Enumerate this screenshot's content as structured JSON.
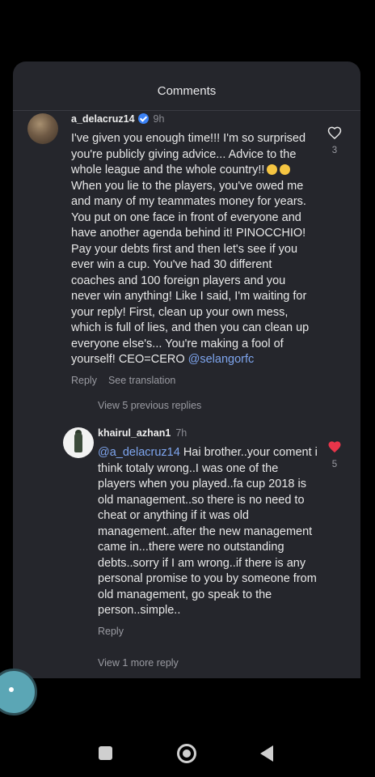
{
  "sheet": {
    "title": "Comments"
  },
  "comments": [
    {
      "username": "a_delacruz14",
      "verified": true,
      "time": "9h",
      "text_1": "I've given you enough time!!! I'm so surprised you're publicly giving advice... Advice to the whole league and the whole country!!",
      "text_2": " When you lie to the players, you've owed me and many of my teammates money for years. You put on one face in front of everyone and have another agenda behind it! PINOCCHIO! Pay your debts first and then let's see if you ever win a cup. You've had 30 different coaches and 100 foreign players and you never win anything! Like I said, I'm waiting for your reply! First, clean up your own mess, which is full of lies, and then you can clean up everyone else's... You're making a fool of yourself! CEO=CERO ",
      "mention": "@selangorfc",
      "reply_label": "Reply",
      "translate_label": "See translation",
      "likes": "3",
      "liked": false,
      "view_replies": "View 5 previous replies"
    },
    {
      "username": "khairul_azhan1",
      "time": "7h",
      "mention": "@a_delacruz14",
      "text": " Hai brother..your coment i think totaly wrong..I was one of the players when you played..fa cup 2018 is old management..so there is no need to cheat or anything if it was old management..after the new management came in...there were no outstanding debts..sorry if I am wrong..if there is any personal promise to you by someone from old management, go speak to the person..simple..",
      "reply_label": "Reply",
      "likes": "5",
      "liked": true,
      "view_replies": "View 1 more reply"
    }
  ],
  "colors": {
    "like_active": "#e8354a",
    "mention": "#7ea5ee",
    "verified": "#3b82f6"
  },
  "icons": [
    "heart-outline-icon",
    "heart-filled-icon",
    "verified-badge-icon",
    "nav-recents-icon",
    "nav-home-icon",
    "nav-back-icon"
  ]
}
